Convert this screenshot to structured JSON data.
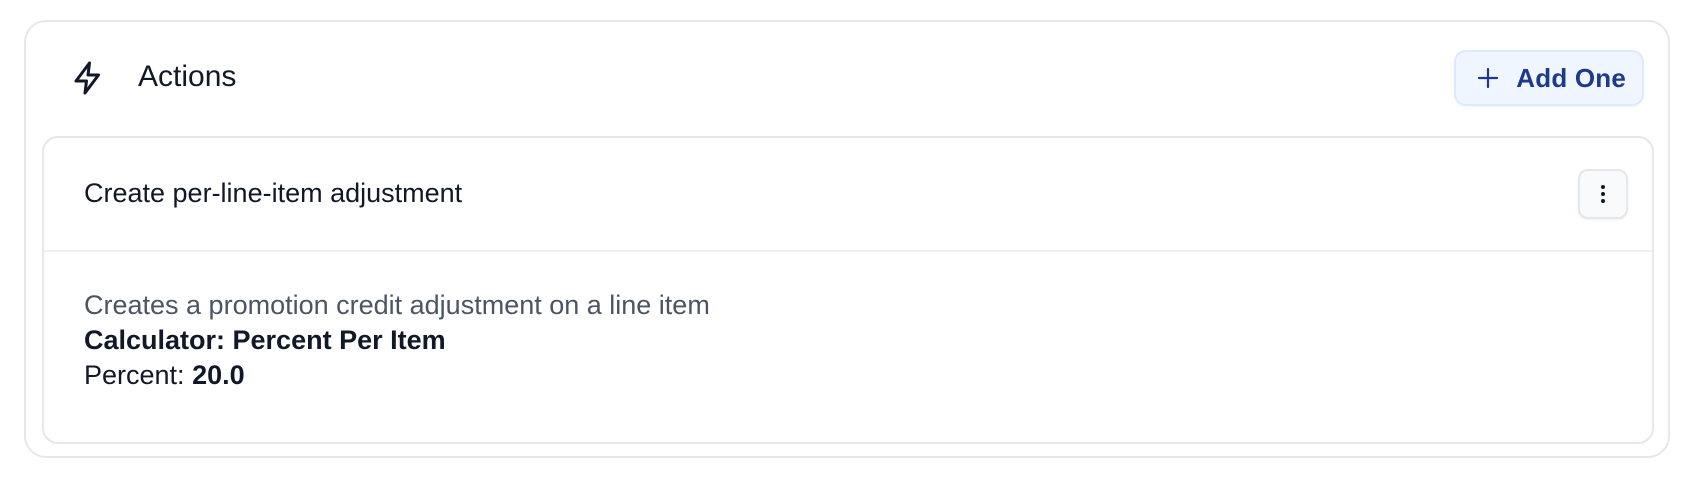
{
  "section": {
    "title": "Actions",
    "icon": "lightning-bolt-icon",
    "add_button_label": "Add One",
    "add_button_icon": "plus-icon"
  },
  "action_card": {
    "title": "Create per-line-item adjustment",
    "menu_icon": "more-vertical-icon",
    "description": "Creates a promotion credit adjustment on a line item",
    "calculator": "Calculator: Percent Per Item",
    "percent_label": "Percent: ",
    "percent_value": "20.0"
  },
  "colors": {
    "border": "#e5e7eb",
    "add_button_bg": "#eff6ff",
    "add_button_text": "#1e3a8a",
    "muted_text": "#4b5563",
    "text": "#111827"
  }
}
